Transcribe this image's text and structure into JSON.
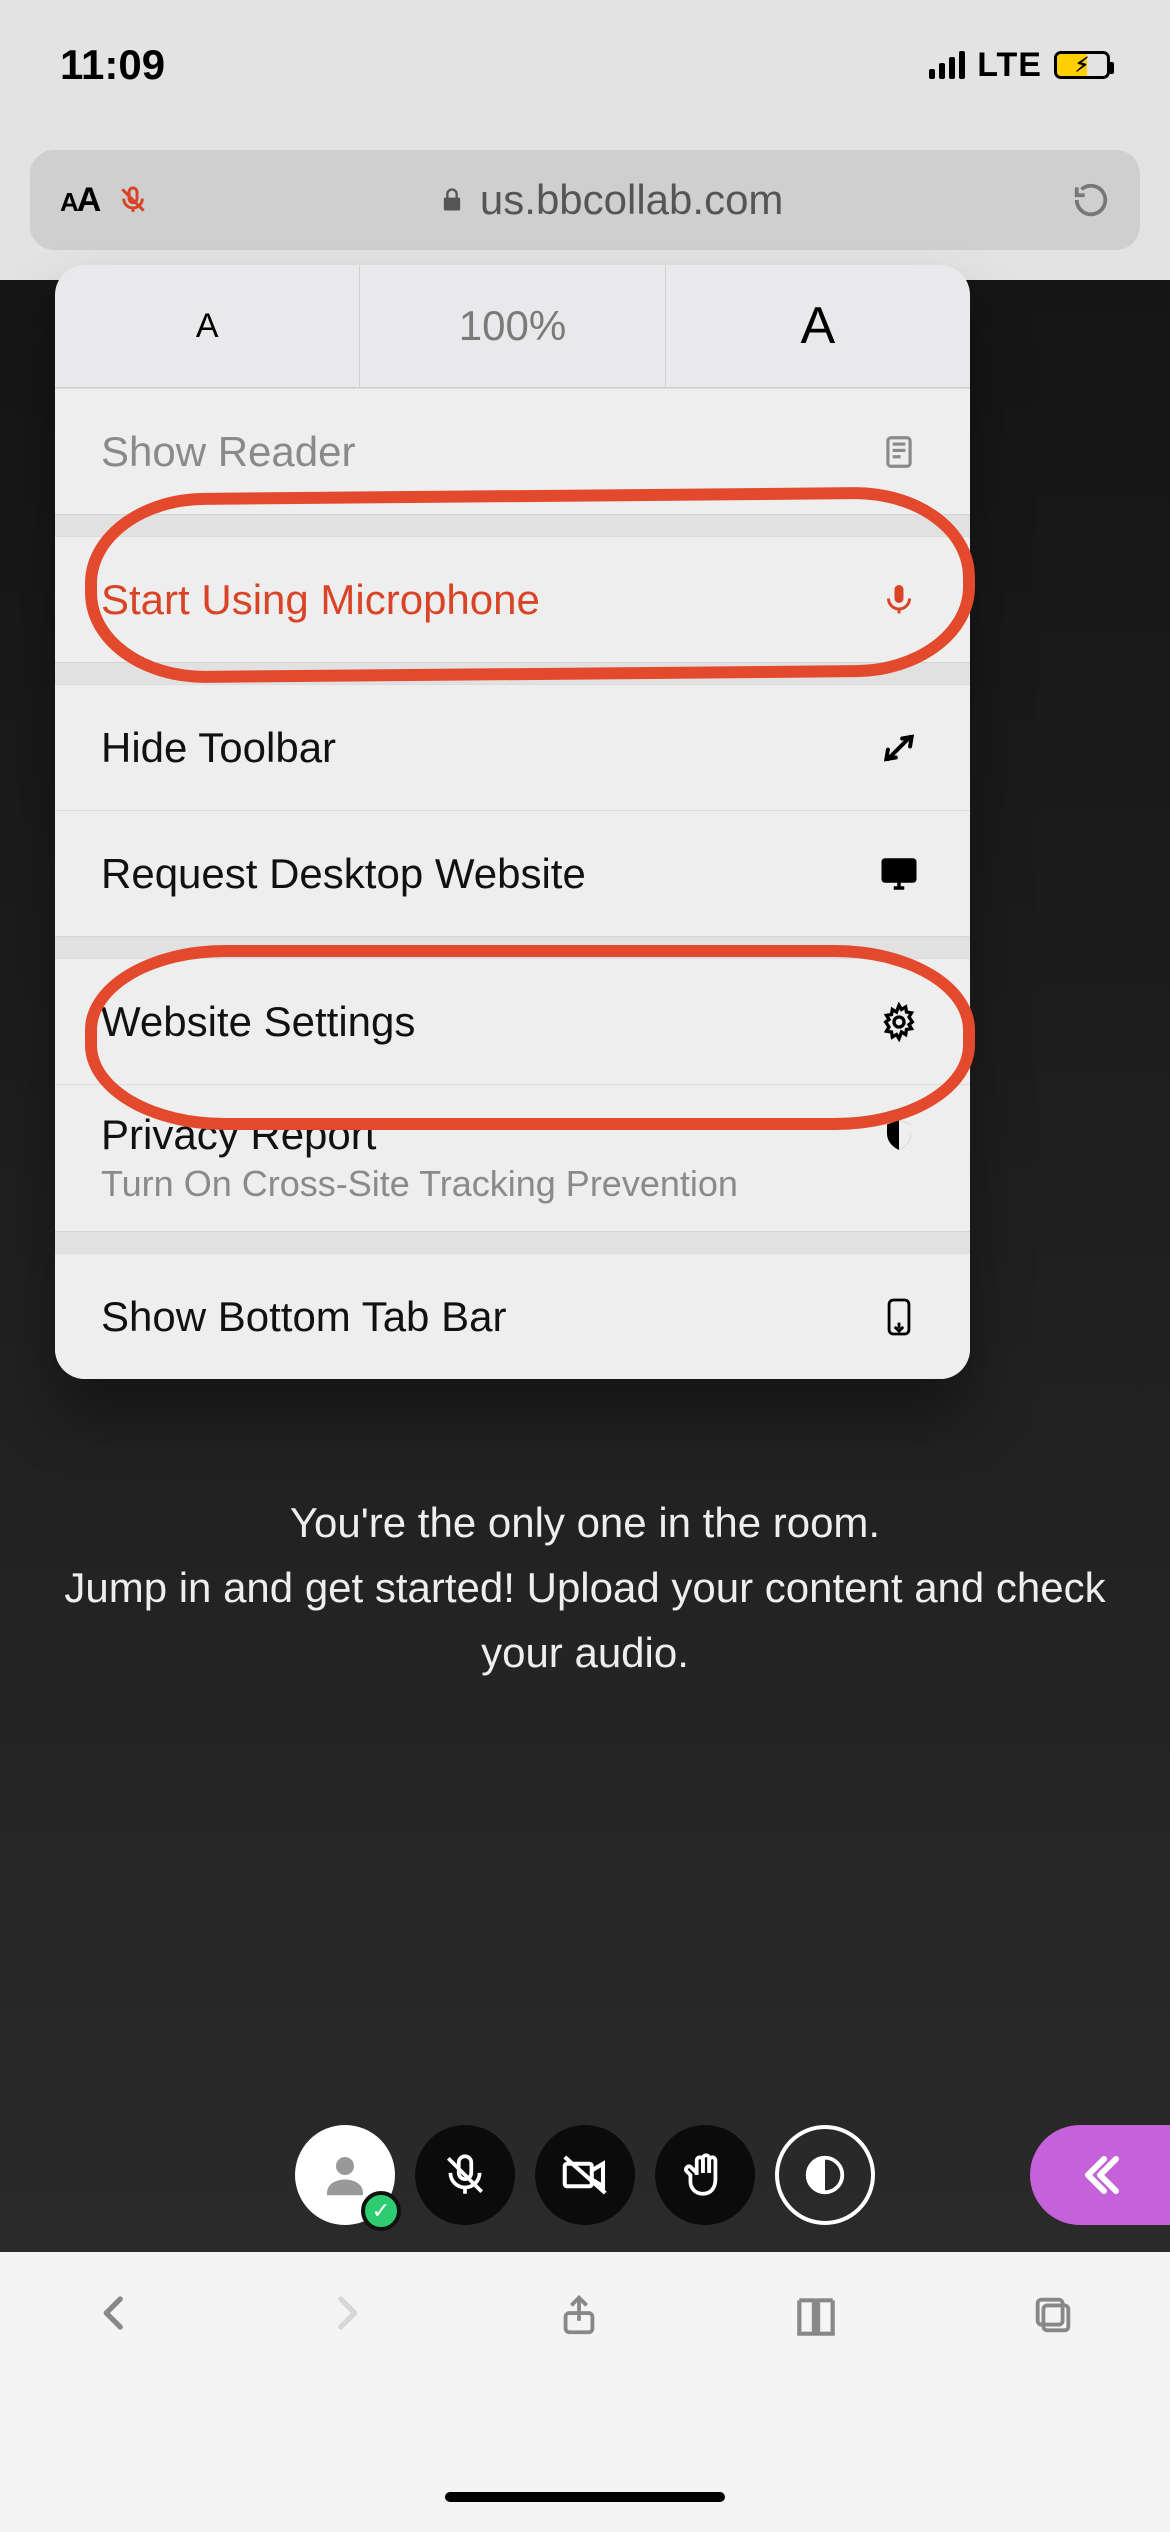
{
  "status": {
    "time": "11:09",
    "network": "LTE"
  },
  "urlbar": {
    "domain": "us.bbcollab.com"
  },
  "popover": {
    "zoom": "100%",
    "reader_label": "Show Reader",
    "mic_label": "Start Using Microphone",
    "hide_toolbar_label": "Hide Toolbar",
    "request_desktop_label": "Request Desktop Website",
    "website_settings_label": "Website Settings",
    "privacy_report_label": "Privacy Report",
    "privacy_report_sub": "Turn On Cross-Site Tracking Prevention",
    "show_bottom_tab_label": "Show Bottom Tab Bar"
  },
  "page": {
    "message": "You're the only one in the room.\nJump in and get started! Upload your content and check your audio."
  }
}
